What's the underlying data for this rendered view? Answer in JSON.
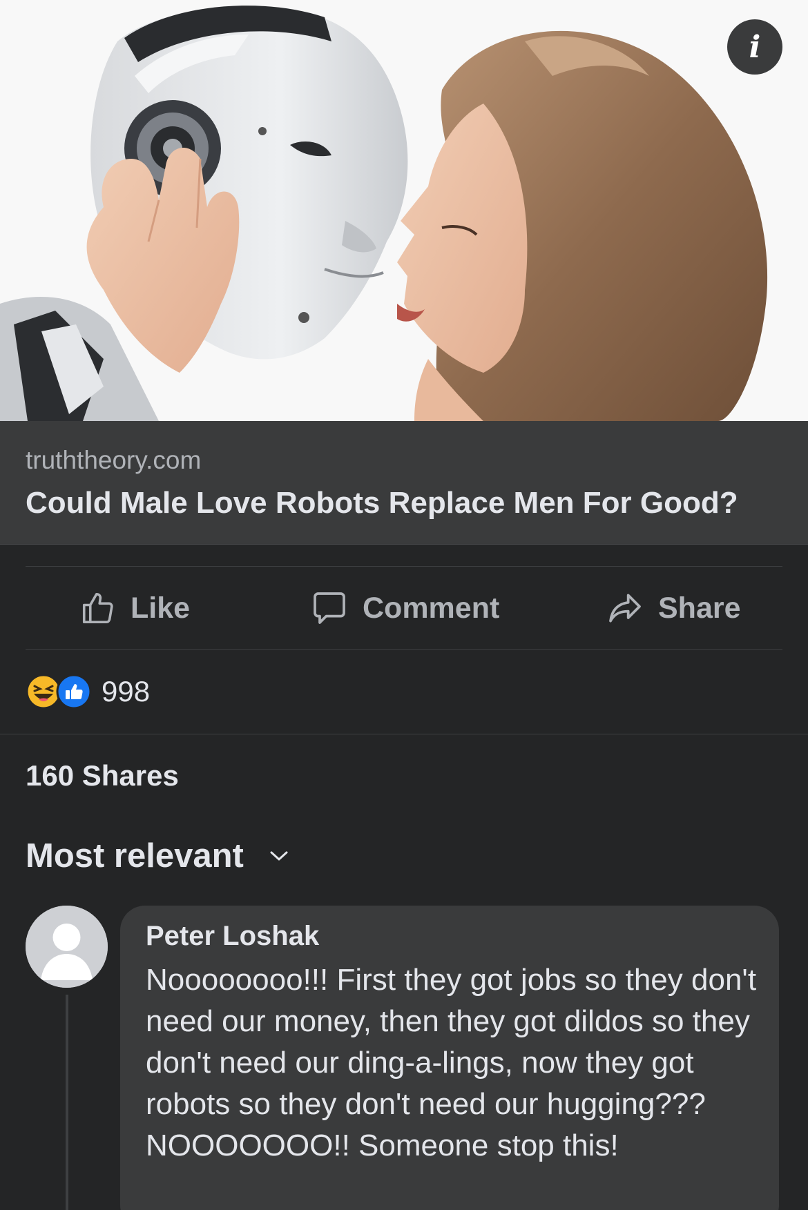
{
  "image": {
    "icon": "info-icon",
    "info_glyph": "i"
  },
  "link_preview": {
    "domain": "truththeory.com",
    "title": "Could Male Love Robots Replace Men For Good?"
  },
  "actions": {
    "like": {
      "label": "Like",
      "icon": "thumbs-up-icon"
    },
    "comment": {
      "label": "Comment",
      "icon": "comment-bubble-icon"
    },
    "share": {
      "label": "Share",
      "icon": "share-arrow-icon"
    }
  },
  "reactions": {
    "icons": [
      "haha-reaction-icon",
      "like-reaction-icon"
    ],
    "count": "998"
  },
  "shares": "160 Shares",
  "sort": {
    "label": "Most relevant",
    "icon": "chevron-down-icon"
  },
  "comments": [
    {
      "author": "Peter Loshak",
      "text": "Noooooooo!!! First they got jobs so they don't need our money, then they got dildos so they don't need our ding-a-lings, now they got robots so they don't need our hugging??? NOOOOOOO!! Someone stop this!"
    }
  ],
  "colors": {
    "background": "#242526",
    "card": "#3a3b3c",
    "primary_text": "#e4e6eb",
    "secondary_text": "#b0b3b8",
    "like_blue": "#1877f2",
    "haha_yellow": "#f7b928"
  }
}
